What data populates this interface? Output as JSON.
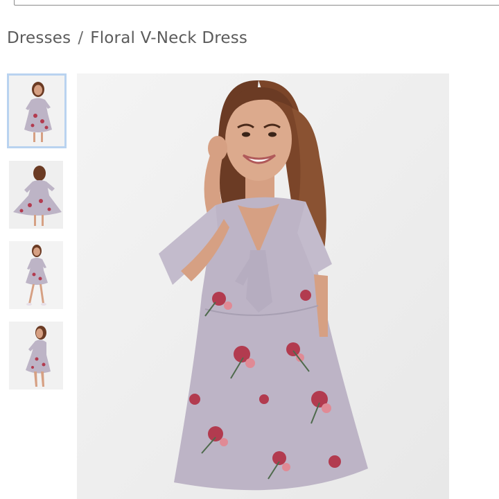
{
  "breadcrumb": {
    "category": "Dresses",
    "separator": "/",
    "current": "Floral V-Neck Dress"
  },
  "gallery": {
    "thumbnails": [
      {
        "icon": "dress-front-thumbnail",
        "selected": true
      },
      {
        "icon": "dress-back-thumbnail",
        "selected": false
      },
      {
        "icon": "dress-walking-thumbnail",
        "selected": false
      },
      {
        "icon": "dress-side-thumbnail",
        "selected": false
      }
    ],
    "main_image": "model-floral-dress-photo"
  },
  "colors": {
    "text": "#5b5b5b",
    "thumb_border": "#b9d3f0",
    "dress": "#bdb4c6",
    "flower": "#b23b4f",
    "hair": "#6b3b24",
    "skin": "#d6a083"
  }
}
